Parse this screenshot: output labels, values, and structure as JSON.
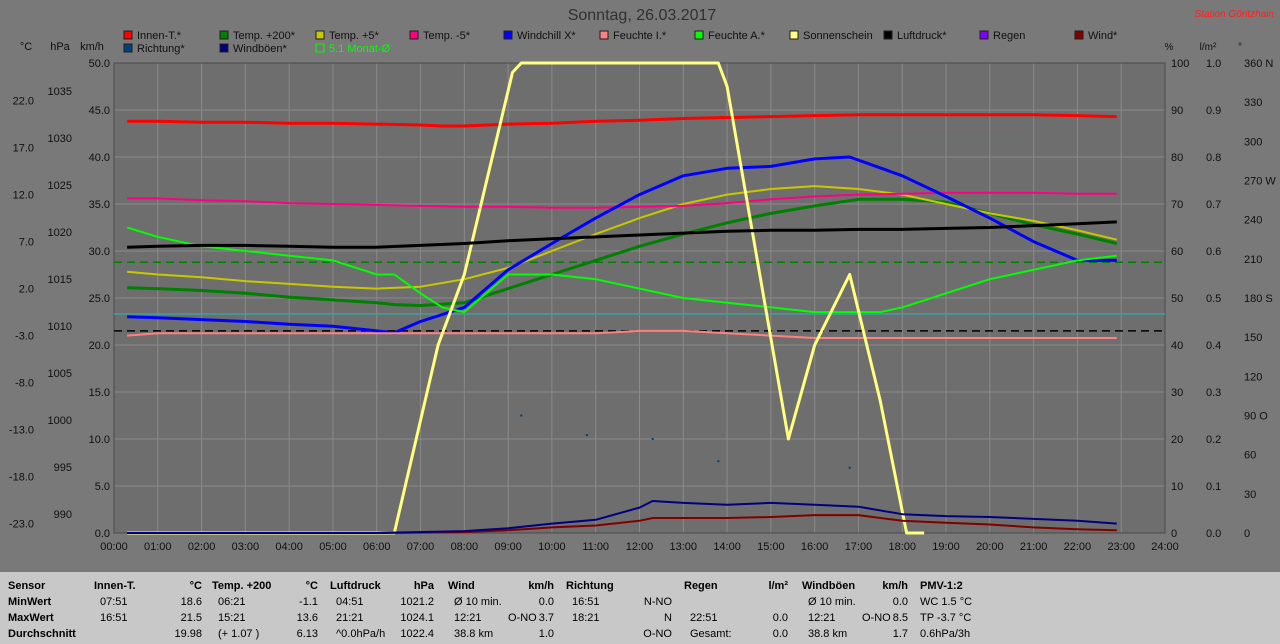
{
  "title": "Sonntag, 26.03.2017",
  "station": "Station Göritzhain",
  "colors": {
    "background": "#797979",
    "plot": "#6e6e6e",
    "station": "#ff2020"
  },
  "axes": {
    "left_units": [
      "°C",
      "hPa",
      "km/h"
    ],
    "right_units": [
      "%",
      "l/m²",
      "°"
    ],
    "celsius_ticks": [
      "22.0",
      "17.0",
      "12.0",
      "7.0",
      "2.0",
      "-3.0",
      "-8.0",
      "-13.0",
      "-18.0",
      "-23.0"
    ],
    "hpa_ticks": [
      "1035",
      "1030",
      "1025",
      "1020",
      "1015",
      "1010",
      "1005",
      "1000",
      "995",
      "990"
    ],
    "kmh_ticks": [
      "50.0",
      "45.0",
      "40.0",
      "35.0",
      "30.0",
      "25.0",
      "20.0",
      "15.0",
      "10.0",
      "5.0",
      "0.0"
    ],
    "pct_ticks": [
      "100",
      "90",
      "80",
      "70",
      "60",
      "50",
      "40",
      "30",
      "20",
      "10",
      "0"
    ],
    "rain_ticks": [
      "1.0",
      "0.9",
      "0.8",
      "0.7",
      "0.6",
      "0.5",
      "0.4",
      "0.3",
      "0.2",
      "0.1",
      "0.0"
    ],
    "deg_ticks": [
      "360 N",
      "330",
      "300",
      "270 W",
      "240",
      "210",
      "180 S",
      "150",
      "120",
      "90 O",
      "60",
      "30",
      "0"
    ],
    "x_ticks": [
      "00:00",
      "01:00",
      "02:00",
      "03:00",
      "04:00",
      "05:00",
      "06:00",
      "07:00",
      "08:00",
      "09:00",
      "10:00",
      "11:00",
      "12:00",
      "13:00",
      "14:00",
      "15:00",
      "16:00",
      "17:00",
      "18:00",
      "19:00",
      "20:00",
      "21:00",
      "22:00",
      "23:00",
      "24:00"
    ]
  },
  "legend": [
    {
      "label": "Innen-T.*",
      "color": "#ff0000"
    },
    {
      "label": "Temp. +200*",
      "color": "#008000"
    },
    {
      "label": "Temp. +5*",
      "color": "#c8c800"
    },
    {
      "label": "Temp. -5*",
      "color": "#ff0080"
    },
    {
      "label": "Windchill X*",
      "color": "#0000ff"
    },
    {
      "label": "Feuchte I.*",
      "color": "#ff8080"
    },
    {
      "label": "Feuchte A.*",
      "color": "#00ff00"
    },
    {
      "label": "Sonnenschein",
      "color": "#ffff80"
    },
    {
      "label": "Luftdruck*",
      "color": "#000000"
    },
    {
      "label": "Regen",
      "color": "#8000ff"
    },
    {
      "label": "Wind*",
      "color": "#800000"
    },
    {
      "label": "Richtung*",
      "color": "#004080"
    },
    {
      "label": "Windböen*",
      "color": "#000080"
    },
    {
      "label": "5.1 Monat-Ø",
      "color": "#00ff00",
      "outline": true
    }
  ],
  "chart_data": {
    "type": "line",
    "title": "Sonntag, 26.03.2017",
    "x_unit": "hour",
    "xlim": [
      0,
      24
    ],
    "reference_lines": [
      {
        "axis": "celsius",
        "value": 5.8,
        "color": "#008000",
        "style": "dashed"
      },
      {
        "axis": "hpa",
        "value": 1011.5,
        "color": "#000000",
        "style": "dashed"
      },
      {
        "axis": "celsius",
        "value": 0.3,
        "color": "#40a0a0",
        "style": "solid"
      }
    ],
    "series": [
      {
        "name": "Innen-T.*",
        "axis": "celsius",
        "color": "#ff0000",
        "width": 3,
        "x": [
          0.3,
          1,
          2,
          3,
          4,
          5,
          6,
          7,
          7.5,
          8,
          9,
          10,
          11,
          12,
          13,
          14,
          15,
          16,
          17,
          18,
          19,
          20,
          21,
          22,
          22.9
        ],
        "y": [
          20.8,
          20.8,
          20.7,
          20.7,
          20.6,
          20.6,
          20.5,
          20.4,
          20.3,
          20.3,
          20.5,
          20.6,
          20.8,
          20.9,
          21.1,
          21.2,
          21.3,
          21.4,
          21.5,
          21.5,
          21.5,
          21.5,
          21.5,
          21.4,
          21.3
        ]
      },
      {
        "name": "Temp. +200*",
        "axis": "celsius",
        "color": "#008000",
        "width": 3,
        "x": [
          0.3,
          1,
          2,
          3,
          4,
          5,
          6,
          6.4,
          7,
          8,
          9,
          10,
          11,
          12,
          13,
          14,
          15,
          16,
          17,
          18,
          19,
          20,
          21,
          22,
          22.9
        ],
        "y": [
          3.1,
          3.0,
          2.8,
          2.5,
          2.1,
          1.8,
          1.5,
          1.3,
          1.2,
          1.5,
          3.0,
          4.5,
          6.0,
          7.5,
          8.8,
          10.0,
          11.0,
          11.8,
          12.5,
          12.5,
          12.2,
          11.0,
          9.8,
          8.8,
          7.8
        ]
      },
      {
        "name": "Temp. +5*",
        "axis": "celsius",
        "color": "#c8c800",
        "width": 2,
        "x": [
          0.3,
          1,
          2,
          3,
          4,
          5,
          6,
          7,
          8,
          9,
          10,
          11,
          12,
          13,
          14,
          15,
          16,
          17,
          18,
          19,
          20,
          21,
          22,
          22.9
        ],
        "y": [
          4.8,
          4.5,
          4.2,
          3.8,
          3.5,
          3.2,
          3.0,
          3.2,
          4.0,
          5.2,
          7.0,
          8.8,
          10.5,
          12.0,
          13.0,
          13.6,
          13.9,
          13.6,
          13.0,
          12.0,
          11.0,
          10.2,
          9.2,
          8.2
        ]
      },
      {
        "name": "Temp. -5*",
        "axis": "celsius",
        "color": "#ff0080",
        "width": 2,
        "x": [
          0.3,
          1,
          2,
          3,
          4,
          5,
          6,
          7,
          8,
          9,
          10,
          11,
          12,
          13,
          14,
          15,
          16,
          17,
          18,
          19,
          20,
          21,
          22,
          22.9
        ],
        "y": [
          12.6,
          12.6,
          12.4,
          12.3,
          12.1,
          12.0,
          11.9,
          11.8,
          11.7,
          11.7,
          11.6,
          11.6,
          11.7,
          11.8,
          12.1,
          12.5,
          12.8,
          13.0,
          13.1,
          13.2,
          13.2,
          13.2,
          13.1,
          13.1
        ]
      },
      {
        "name": "Windchill X*",
        "axis": "celsius",
        "color": "#0000ff",
        "width": 3,
        "x": [
          0.3,
          1,
          2,
          3,
          4,
          5,
          6,
          6.4,
          7,
          8,
          9,
          10,
          11,
          12,
          13,
          14,
          15,
          16,
          16.8,
          18,
          19,
          20,
          21,
          22,
          22.9
        ],
        "y": [
          0.0,
          -0.1,
          -0.3,
          -0.5,
          -0.8,
          -1.0,
          -1.5,
          -1.7,
          -0.5,
          1.0,
          5.0,
          7.8,
          10.5,
          13.0,
          15.0,
          15.8,
          16.0,
          16.8,
          17.0,
          15.0,
          12.8,
          10.5,
          8.0,
          6.0,
          6.0
        ]
      },
      {
        "name": "Feuchte I.*",
        "axis": "pct",
        "color": "#ff8080",
        "width": 2,
        "x": [
          0.3,
          1,
          2,
          3,
          4,
          5,
          6,
          7,
          8,
          9,
          10,
          11,
          12,
          13,
          14,
          15,
          16,
          17,
          18,
          19,
          20,
          21,
          22,
          22.9
        ],
        "y": [
          42,
          42.5,
          42.5,
          42.5,
          42.5,
          42.5,
          42.5,
          42.5,
          42.5,
          42.5,
          42.5,
          42.5,
          43,
          43,
          42.5,
          42,
          41.5,
          41.5,
          41.5,
          41.5,
          41.5,
          41.5,
          41.5,
          41.5
        ]
      },
      {
        "name": "Feuchte A.*",
        "axis": "pct",
        "color": "#00ff00",
        "width": 2,
        "x": [
          0.3,
          1,
          2,
          3,
          4,
          5,
          6,
          6.4,
          7,
          7.5,
          8,
          9,
          10,
          11,
          12,
          13,
          14,
          15,
          16,
          17,
          17.5,
          18,
          19,
          20,
          21,
          22,
          22.9
        ],
        "y": [
          65,
          63,
          61,
          60,
          59,
          58,
          55,
          55,
          51,
          48,
          47,
          55,
          55,
          54,
          52,
          50,
          49,
          48,
          47,
          47,
          47,
          48,
          51,
          54,
          56,
          58,
          59
        ]
      },
      {
        "name": "Sonnenschein",
        "axis": "pct",
        "color": "#ffff80",
        "width": 3,
        "x": [
          0.3,
          6.4,
          7.4,
          8,
          9.1,
          9.3,
          13.8,
          14,
          15.4,
          16,
          16.8,
          17.5,
          18.1,
          18.5
        ],
        "y": [
          0,
          0,
          40,
          55,
          98,
          100,
          100,
          95,
          20,
          40,
          55,
          28,
          0,
          0
        ]
      },
      {
        "name": "Luftdruck*",
        "axis": "hpa",
        "color": "#000000",
        "width": 3,
        "x": [
          0.3,
          1,
          2,
          3,
          4,
          5,
          6,
          7,
          8,
          9,
          10,
          11,
          12,
          13,
          14,
          15,
          16,
          17,
          18,
          19,
          20,
          21,
          22,
          22.9
        ],
        "y": [
          1020.4,
          1020.5,
          1020.6,
          1020.6,
          1020.5,
          1020.4,
          1020.4,
          1020.6,
          1020.8,
          1021.1,
          1021.3,
          1021.5,
          1021.7,
          1021.9,
          1022.1,
          1022.2,
          1022.2,
          1022.3,
          1022.3,
          1022.4,
          1022.5,
          1022.7,
          1022.9,
          1023.1
        ]
      },
      {
        "name": "Wind*",
        "axis": "kmh",
        "color": "#800000",
        "width": 2,
        "x": [
          0.3,
          6,
          8,
          9,
          10,
          11,
          12,
          12.3,
          13,
          14,
          15,
          16,
          17,
          18,
          19,
          20,
          21,
          22,
          22.9
        ],
        "y": [
          0,
          0,
          0.1,
          0.3,
          0.6,
          0.8,
          1.3,
          1.6,
          1.6,
          1.6,
          1.7,
          1.9,
          1.9,
          1.3,
          1.1,
          0.9,
          0.6,
          0.4,
          0.3
        ]
      },
      {
        "name": "Windböen*",
        "axis": "kmh",
        "color": "#000080",
        "width": 2,
        "x": [
          0.3,
          6,
          8,
          9,
          10,
          11,
          12,
          12.3,
          13,
          14,
          15,
          16,
          17,
          18,
          19,
          20,
          21,
          22,
          22.9
        ],
        "y": [
          0,
          0,
          0.2,
          0.5,
          1.0,
          1.4,
          2.7,
          3.4,
          3.2,
          3.0,
          3.2,
          3.0,
          2.8,
          2.0,
          1.8,
          1.7,
          1.5,
          1.3,
          1.0
        ]
      }
    ],
    "points": [
      {
        "name": "Richtung*",
        "axis": "deg",
        "color": "#004080",
        "x": [
          9.3,
          10.8,
          12.3,
          13.8,
          16.8
        ],
        "y": [
          90,
          75,
          72,
          55,
          50
        ]
      }
    ]
  },
  "summary": {
    "columns": [
      {
        "header": "Sensor",
        "unit": "",
        "rows": [
          "MinWert",
          "MaxWert",
          "Durchschnitt"
        ]
      },
      {
        "header": "Innen-T.",
        "unit": "°C",
        "rows": [
          [
            "07:51",
            "18.6"
          ],
          [
            "16:51",
            "21.5"
          ],
          [
            "",
            "19.98"
          ]
        ]
      },
      {
        "header": "Temp. +200",
        "unit": "°C",
        "rows": [
          [
            "06:21",
            "-1.1"
          ],
          [
            "15:21",
            "13.6"
          ],
          [
            "(+ 1.07 )",
            "6.13"
          ]
        ]
      },
      {
        "header": "Luftdruck",
        "unit": "hPa",
        "rows": [
          [
            "04:51",
            "1021.2"
          ],
          [
            "21:21",
            "1024.1"
          ],
          [
            "^0.0hPa/h",
            "1022.4"
          ]
        ]
      },
      {
        "header": "Wind",
        "unit": "km/h",
        "rows": [
          [
            "Ø 10 min.",
            "",
            "0.0"
          ],
          [
            "12:21",
            "O-NO",
            "3.7"
          ],
          [
            "38.8 km",
            "",
            "1.0"
          ]
        ]
      },
      {
        "header": "Richtung",
        "unit": "",
        "rows": [
          [
            "16:51",
            "N-NO"
          ],
          [
            "18:21",
            "N"
          ],
          [
            "",
            "O-NO"
          ]
        ]
      },
      {
        "header": "Regen",
        "unit": "l/m²",
        "rows": [
          [
            "",
            ""
          ],
          [
            "22:51",
            "0.0"
          ],
          [
            "Gesamt:",
            "0.0"
          ]
        ]
      },
      {
        "header": "Windböen",
        "unit": "km/h",
        "rows": [
          [
            "Ø 10 min.",
            "",
            "0.0"
          ],
          [
            "12:21",
            "O-NO",
            "8.5"
          ],
          [
            "38.8 km",
            "",
            "1.7"
          ]
        ]
      },
      {
        "header": "PMV-1:2",
        "unit": "",
        "rows": [
          "WC 1.5 °C",
          "TP -3.7 °C",
          "0.6hPa/3h"
        ]
      }
    ]
  }
}
